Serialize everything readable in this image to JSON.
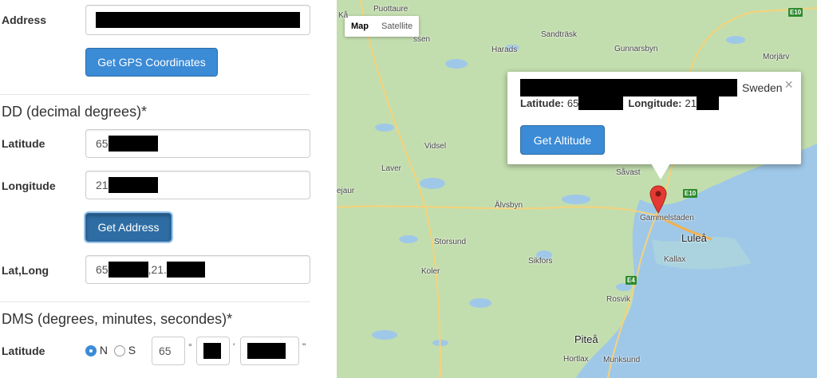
{
  "form": {
    "address_label": "Address",
    "get_gps_button": "Get GPS Coordinates",
    "dd_title": "DD (decimal degrees)*",
    "latitude_label": "Latitude",
    "latitude_value": "65",
    "longitude_label": "Longitude",
    "longitude_value": "21",
    "get_address_button": "Get Address",
    "latlong_label": "Lat,Long",
    "latlong_value_a": "65",
    "latlong_value_b": ",21.",
    "dms_title": "DMS (degrees, minutes, secondes)*",
    "dms_latitude_label": "Latitude",
    "radio_n": "N",
    "radio_s": "S",
    "dms_degrees": "65",
    "degree_symbol": "°",
    "minute_symbol": "'",
    "second_symbol": "\""
  },
  "map": {
    "toggle_map": "Map",
    "toggle_satellite": "Satellite",
    "popup": {
      "country": "Sweden",
      "close": "×",
      "lat_label": "Latitude:",
      "lat_value": "65",
      "lng_label": "Longitude:",
      "lng_value": "21",
      "get_altitude_button": "Get Altitude"
    },
    "places": {
      "puottaure": "Puottaure",
      "kal": "Kå",
      "sandtrask": "Sandträsk",
      "harads": "Harads",
      "gunnarsbyn": "Gunnarsbyn",
      "morjarv": "Morjärv",
      "ssen": "ssen",
      "vidsel": "Vidsel",
      "laver": "Laver",
      "ejaur": "ejaur",
      "alvsbyn": "Älvsbyn",
      "savast": "Såvast",
      "gammelstaden": "Gammelstaden",
      "lulea": "Luleå",
      "storsund": "Storsund",
      "kallax": "Kallax",
      "sikfors": "Sikfors",
      "koler": "Koler",
      "rosvik": "Rosvik",
      "pitea": "Piteå",
      "hortlax": "Hortlax",
      "munksund": "Munksund"
    },
    "roads": {
      "e10": "E10",
      "e4": "E4"
    }
  }
}
